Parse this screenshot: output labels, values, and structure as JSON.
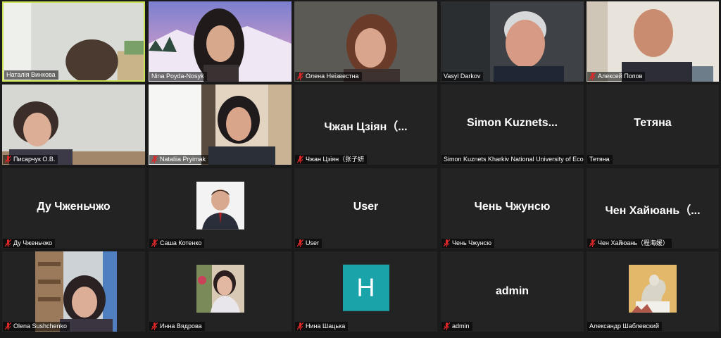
{
  "participants": [
    {
      "name": "Наталія Винкова",
      "muted": false,
      "active": true
    },
    {
      "name": "Nina Poyda-Nosyk",
      "muted": false
    },
    {
      "name": "Олена Неізвестна",
      "muted": true
    },
    {
      "name": "Vasyl Darkov",
      "muted": false
    },
    {
      "name": "Алексей Попов",
      "muted": true
    },
    {
      "name": "Писарчук О.В.",
      "muted": true
    },
    {
      "name": "Nataliia Pryimak",
      "muted": true
    },
    {
      "name": "Чжан Цзіян（张子妍",
      "display": "Чжан Цзіян（...",
      "muted": true
    },
    {
      "name": "Simon Kuznets Kharkiv National University of Eco...",
      "display": "Simon  Kuznets...",
      "muted": false
    },
    {
      "name": "Тетяна",
      "display": "Тетяна",
      "muted": false
    },
    {
      "name": "Ду Чженьчжо",
      "display": "Ду Чженьчжо",
      "muted": true
    },
    {
      "name": "Саша Котенко",
      "muted": true
    },
    {
      "name": "User",
      "display": "User",
      "muted": true
    },
    {
      "name": "Чень Чжунсю",
      "display": "Чень Чжунсю",
      "muted": true
    },
    {
      "name": "Чен Хайюань（程海媛）",
      "display": "Чен  Хайюань（...",
      "muted": true
    },
    {
      "name": "Olena Sushchenko",
      "muted": true
    },
    {
      "name": "Инна Вядрова",
      "muted": true
    },
    {
      "name": "Нина Шацька",
      "muted": true,
      "avatar_letter": "H"
    },
    {
      "name": "admin",
      "display": "admin",
      "muted": true
    },
    {
      "name": "Александр Шаблевский",
      "muted": false
    }
  ],
  "colors": {
    "active_border": "#c9e256",
    "mute": "#e02828",
    "letter_avatar": "#1aa3a8"
  }
}
